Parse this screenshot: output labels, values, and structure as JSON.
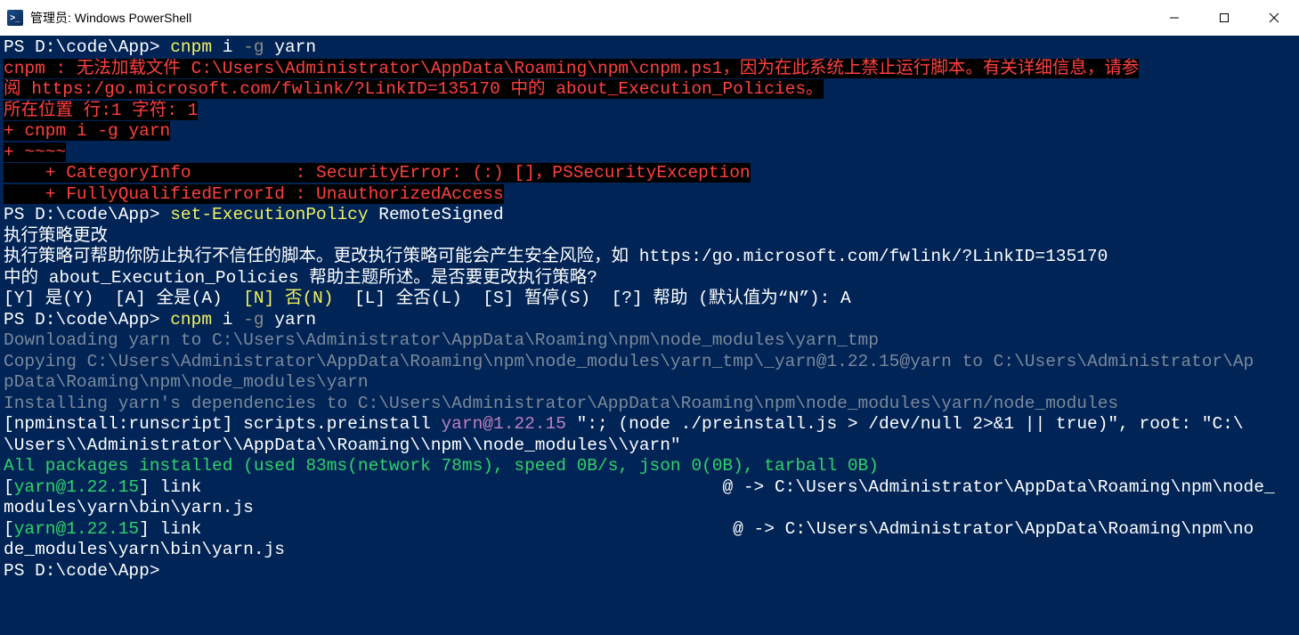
{
  "titlebar": {
    "title": "管理员: Windows PowerShell"
  },
  "lines": {
    "l1_prompt": "PS D:\\code\\App> ",
    "l1_cmd": "cnpm ",
    "l1_args": "i ",
    "l1_flag": "-g ",
    "l1_pkg": "yarn",
    "l2": "cnpm : 无法加载文件 C:\\Users\\Administrator\\AppData\\Roaming\\npm\\cnpm.ps1，因为在此系统上禁止运行脚本。有关详细信息，请参",
    "l3": "阅 https:/go.microsoft.com/fwlink/?LinkID=135170 中的 about_Execution_Policies。",
    "l4": "所在位置 行:1 字符: 1",
    "l5": "+ cnpm i -g yarn",
    "l6": "+ ~~~~",
    "l7": "    + CategoryInfo          : SecurityError: (:) []，PSSecurityException",
    "l8": "    + FullyQualifiedErrorId : UnauthorizedAccess",
    "l9_prompt": "PS D:\\code\\App> ",
    "l9_cmd": "set-ExecutionPolicy ",
    "l9_arg": "RemoteSigned",
    "l10": "",
    "l11": "执行策略更改",
    "l12": "执行策略可帮助你防止执行不信任的脚本。更改执行策略可能会产生安全风险，如 https:/go.microsoft.com/fwlink/?LinkID=135170",
    "l13": "中的 about_Execution_Policies 帮助主题所述。是否要更改执行策略?",
    "l14_a": "[Y] 是(Y)  [A] 全是(A)  ",
    "l14_n": "[N] 否(N)",
    "l14_b": "  [L] 全否(L)  [S] 暂停(S)  [?] 帮助 (默认值为“N”): A",
    "l15_prompt": "PS D:\\code\\App> ",
    "l15_cmd": "cnpm ",
    "l15_args": "i ",
    "l15_flag": "-g ",
    "l15_pkg": "yarn",
    "l16": "Downloading yarn to C:\\Users\\Administrator\\AppData\\Roaming\\npm\\node_modules\\yarn_tmp",
    "l17": "Copying C:\\Users\\Administrator\\AppData\\Roaming\\npm\\node_modules\\yarn_tmp\\_yarn@1.22.15@yarn to C:\\Users\\Administrator\\Ap",
    "l18": "pData\\Roaming\\npm\\node_modules\\yarn",
    "l19": "Installing yarn's dependencies to C:\\Users\\Administrator\\AppData\\Roaming\\npm\\node_modules\\yarn/node_modules",
    "l20_a": "[npminstall:runscript] scripts.preinstall ",
    "l20_pkg": "yarn@1.22.15",
    "l20_b": " \":; (node ./preinstall.js > /dev/null 2>&1 || true)\", root: \"C:\\",
    "l21": "\\Users\\\\Administrator\\\\AppData\\\\Roaming\\\\npm\\\\node_modules\\\\yarn\"",
    "l22": "All packages installed (used 83ms(network 78ms), speed 0B/s, json 0(0B), tarball 0B)",
    "l23_a": "[",
    "l23_pkg": "yarn@1.22.15",
    "l23_b": "] link                                                  @ -> C:\\Users\\Administrator\\AppData\\Roaming\\npm\\node_",
    "l24": "modules\\yarn\\bin\\yarn.js",
    "l25_a": "[",
    "l25_pkg": "yarn@1.22.15",
    "l25_b": "] link                                                   @ -> C:\\Users\\Administrator\\AppData\\Roaming\\npm\\no",
    "l26": "de_modules\\yarn\\bin\\yarn.js",
    "l27": "PS D:\\code\\App> "
  }
}
